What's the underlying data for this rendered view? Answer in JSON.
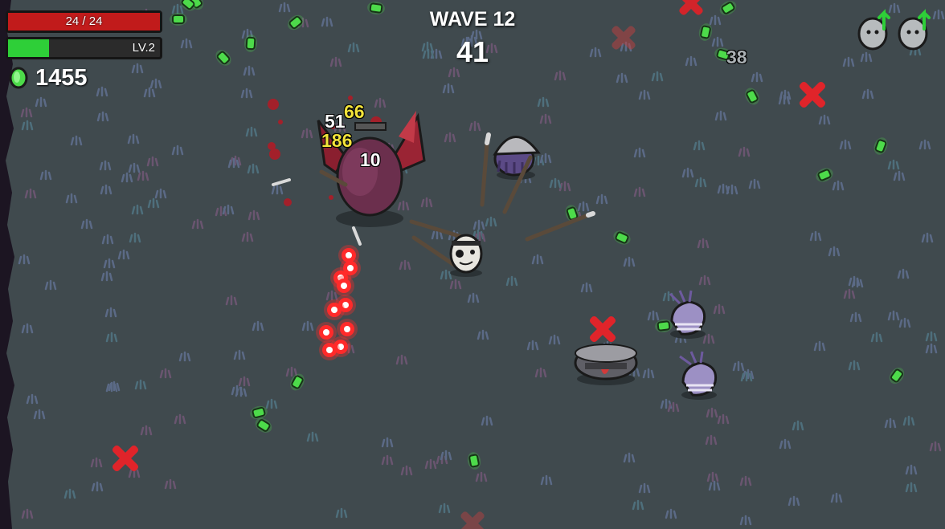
{
  "hud": {
    "health_text": "24 / 24",
    "health_fraction": 1.0,
    "level_text": "LV.2",
    "xp_fraction": 0.27,
    "materials_count": "1455",
    "wave_label": "WAVE 12",
    "timer": "41",
    "pending_upgrades": [
      "level-up-egg-icon",
      "level-up-egg-icon"
    ]
  },
  "damage_numbers": {
    "d1": "51",
    "d2": "66",
    "d3": "186",
    "d4": "10",
    "d5": "38"
  },
  "colors": {
    "ground": "#404a4e",
    "health": "#c11b1b",
    "xp": "#2ecf38",
    "material": "#4ddb4a",
    "enemy_bullet": "#ff2a2a",
    "crit_text": "#f2e33a"
  },
  "entities": {
    "player": "potato-player",
    "boss": "winged-demon-boss",
    "enemies": [
      "helmeted-squid-enemy",
      "larva-enemy",
      "larva-enemy",
      "helmet-slug-enemy"
    ],
    "weapons": "spear"
  }
}
